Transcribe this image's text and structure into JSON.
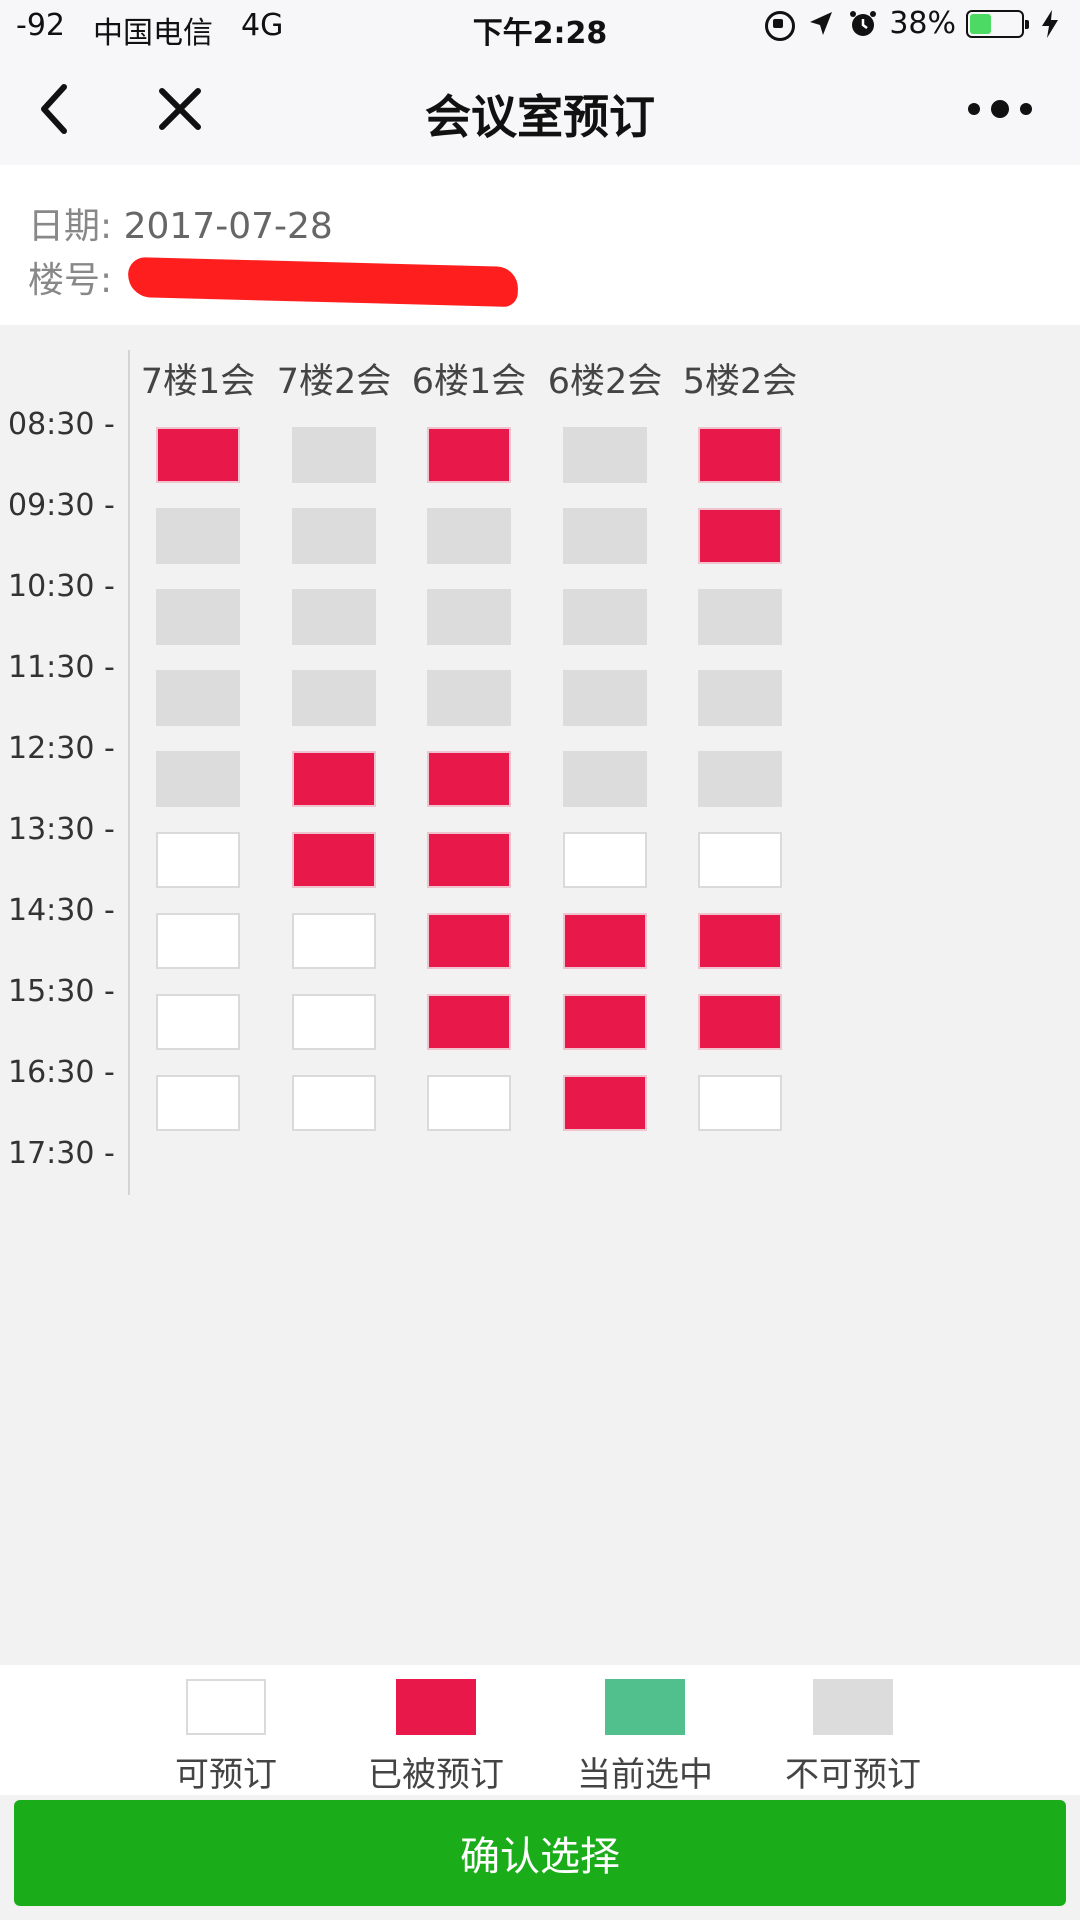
{
  "status_bar": {
    "signal": "-92",
    "carrier": "中国电信",
    "network": "4G",
    "time": "下午2:28",
    "battery_percent": "38%",
    "battery_level": 0.38,
    "battery_color": "#4cd964"
  },
  "nav": {
    "title": "会议室预订",
    "back_icon": "chevron-left-icon",
    "close_icon": "close-icon",
    "more_icon": "more-dots-icon"
  },
  "info": {
    "date_label": "日期:",
    "date_value": "2017-07-28",
    "building_label": "楼号:"
  },
  "rooms": [
    "7楼1会",
    "7楼2会",
    "6楼1会",
    "6楼2会",
    "5楼2会"
  ],
  "times": [
    "08:30 -",
    "09:30 -",
    "10:30 -",
    "11:30 -",
    "12:30 -",
    "13:30 -",
    "14:30 -",
    "15:30 -",
    "16:30 -",
    "17:30 -"
  ],
  "slot_status_rows": [
    [
      "booked",
      "unavailable",
      "booked",
      "unavailable",
      "booked"
    ],
    [
      "unavailable",
      "unavailable",
      "unavailable",
      "unavailable",
      "booked"
    ],
    [
      "unavailable",
      "unavailable",
      "unavailable",
      "unavailable",
      "unavailable"
    ],
    [
      "unavailable",
      "unavailable",
      "unavailable",
      "unavailable",
      "unavailable"
    ],
    [
      "unavailable",
      "booked",
      "booked",
      "unavailable",
      "unavailable"
    ],
    [
      "available",
      "booked",
      "booked",
      "available",
      "available"
    ],
    [
      "available",
      "available",
      "booked",
      "booked",
      "booked"
    ],
    [
      "available",
      "available",
      "booked",
      "booked",
      "booked"
    ],
    [
      "available",
      "available",
      "available",
      "booked",
      "available"
    ]
  ],
  "legend": {
    "available": "可预订",
    "booked": "已被预订",
    "selected": "当前选中",
    "unavailable": "不可预订"
  },
  "colors": {
    "booked": "#e8194a",
    "selected": "#52c08d",
    "unavailable": "#dcdcdc",
    "available": "#ffffff",
    "confirm": "#1aad19"
  },
  "confirm_label": "确认选择"
}
